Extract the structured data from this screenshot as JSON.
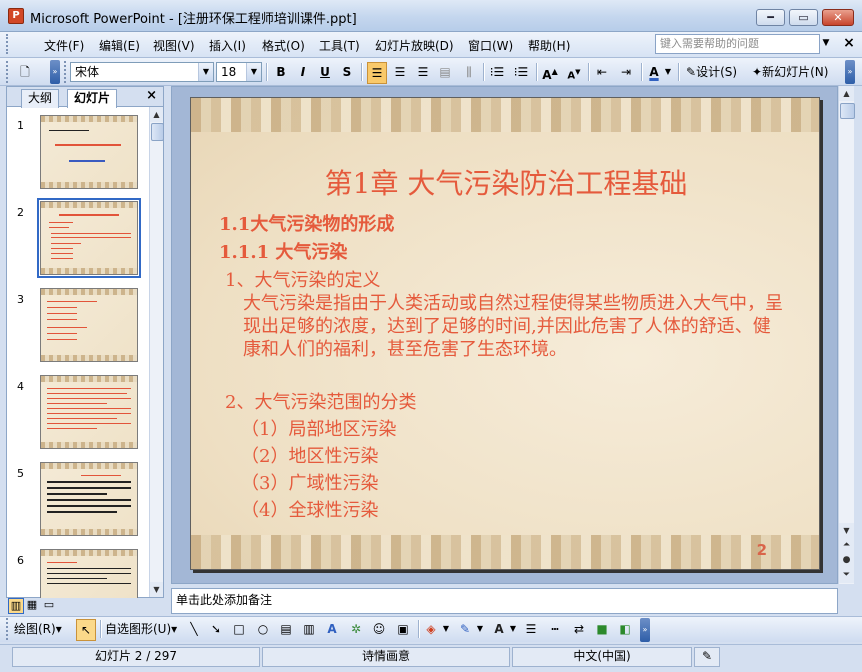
{
  "window": {
    "title": "Microsoft PowerPoint - [注册环保工程师培训课件.ppt]",
    "app_icon_letter": "P",
    "minimize": "━",
    "maximize": "▭",
    "close": "✕"
  },
  "menu": {
    "items": [
      "文件(F)",
      "编辑(E)",
      "视图(V)",
      "插入(I)",
      "格式(O)",
      "工具(T)",
      "幻灯片放映(D)",
      "窗口(W)",
      "帮助(H)"
    ],
    "help_placeholder": "键入需要帮助的问题",
    "mdi_close": "×"
  },
  "toolbar": {
    "font_name": "宋体",
    "font_size": "18",
    "bold": "B",
    "italic": "I",
    "underline": "U",
    "shadow": "S",
    "grow": "A",
    "shrink": "A",
    "design_label": "设计(S)",
    "new_slide_label": "新幻灯片(N)"
  },
  "left_panel": {
    "tab_outline": "大纲",
    "tab_slides": "幻灯片",
    "close": "×",
    "thumbnail_numbers": [
      "1",
      "2",
      "3",
      "4",
      "5",
      "6"
    ],
    "selected": "2"
  },
  "slide": {
    "title": "第1章  大气污染防治工程基础",
    "lines": [
      {
        "text": "1.1大气污染物的形成",
        "style": "l1"
      },
      {
        "text": "1.1.1  大气污染",
        "style": "l1"
      },
      {
        "text": "1、大气污染的定义",
        "style": "l2"
      },
      {
        "text": "大气污染是指由于人类活动或自然过程使得某些物质进入大气中，呈现出足够的浓度，达到了足够的时间,并因此危害了人体的舒适、健康和人们的福利，甚至危害了生态环境。",
        "style": "body"
      },
      {
        "text": "2、大气污染范围的分类",
        "style": "l2"
      },
      {
        "text": "（1）局部地区污染",
        "style": "l2"
      },
      {
        "text": "（2）地区性污染",
        "style": "l2"
      },
      {
        "text": "（3）广域性污染",
        "style": "l2"
      },
      {
        "text": "（4）全球性污染",
        "style": "l2"
      }
    ],
    "number": "2"
  },
  "notes": {
    "placeholder": "单击此处添加备注"
  },
  "drawbar": {
    "draw_label": "绘图(R)",
    "autoshapes_label": "自选图形(U)"
  },
  "status": {
    "slide_position": "幻灯片 2 / 297",
    "design_name": "诗情画意",
    "language": "中文(中国)"
  },
  "colors": {
    "slide_text": "#e55a3c",
    "selection": "#3169c6"
  }
}
